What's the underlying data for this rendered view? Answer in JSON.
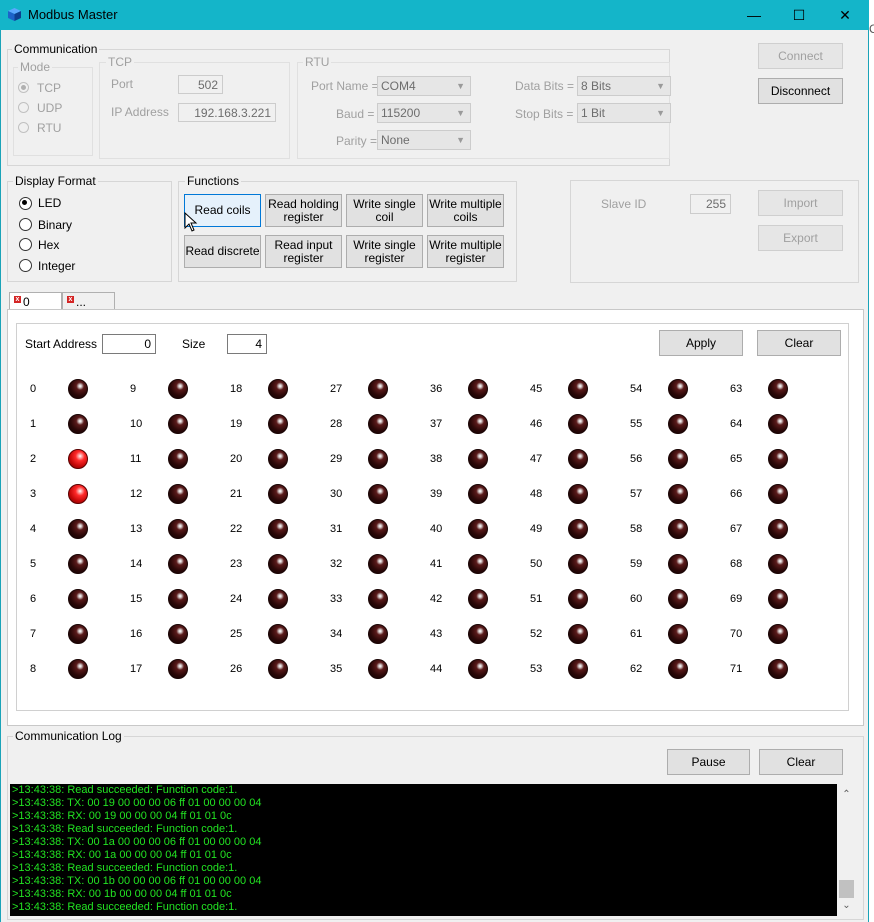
{
  "window": {
    "title": "Modbus Master",
    "minimize_glyph": "—",
    "maximize_glyph": "☐",
    "close_glyph": "✕",
    "stray_text": "C"
  },
  "communication": {
    "label": "Communication",
    "mode": {
      "label": "Mode",
      "options": [
        "TCP",
        "UDP",
        "RTU"
      ],
      "selected": "TCP"
    },
    "tcp": {
      "label": "TCP",
      "port_label": "Port",
      "port_value": "502",
      "ip_label": "IP Address",
      "ip_value": "192.168.3.221"
    },
    "rtu": {
      "label": "RTU",
      "port_name_label": "Port Name =",
      "port_name_value": "COM4",
      "baud_label": "Baud =",
      "baud_value": "115200",
      "parity_label": "Parity =",
      "parity_value": "None",
      "data_bits_label": "Data Bits =",
      "data_bits_value": "8 Bits",
      "stop_bits_label": "Stop Bits =",
      "stop_bits_value": "1 Bit"
    },
    "connect_label": "Connect",
    "disconnect_label": "Disconnect"
  },
  "display_format": {
    "label": "Display Format",
    "options": [
      "LED",
      "Binary",
      "Hex",
      "Integer"
    ],
    "selected": "LED"
  },
  "functions": {
    "label": "Functions",
    "read_coils": "Read coils",
    "read_holding_register": "Read holding register",
    "write_single_coil": "Write single coil",
    "write_multiple_coils": "Write multiple coils",
    "read_discrete": "Read discrete",
    "read_input_register": "Read input register",
    "write_single_register": "Write single register",
    "write_multiple_register": "Write multiple register"
  },
  "slave": {
    "slave_id_label": "Slave ID",
    "slave_id_value": "255",
    "import_label": "Import",
    "export_label": "Export"
  },
  "tabs": [
    "0",
    "..."
  ],
  "coils_panel": {
    "start_address_label": "Start Address",
    "start_address_value": "0",
    "size_label": "Size",
    "size_value": "4",
    "apply_label": "Apply",
    "clear_label": "Clear",
    "count": 72,
    "on_addresses": [
      2,
      3
    ]
  },
  "log": {
    "label": "Communication Log",
    "pause_label": "Pause",
    "clear_label": "Clear",
    "lines": [
      ">13:43:38: Read succeeded: Function code:1.",
      ">13:43:38: TX: 00 19 00 00 00 06 ff 01 00 00 00 04",
      ">13:43:38: RX: 00 19 00 00 00 04 ff 01 01 0c",
      ">13:43:38: Read succeeded: Function code:1.",
      ">13:43:38: TX: 00 1a 00 00 00 06 ff 01 00 00 00 04",
      ">13:43:38: RX: 00 1a 00 00 00 04 ff 01 01 0c",
      ">13:43:38: Read succeeded: Function code:1.",
      ">13:43:38: TX: 00 1b 00 00 00 06 ff 01 00 00 00 04",
      ">13:43:38: RX: 00 1b 00 00 00 04 ff 01 01 0c",
      ">13:43:38: Read succeeded: Function code:1."
    ],
    "scroll_up_glyph": "⌃",
    "scroll_down_glyph": "⌄"
  }
}
